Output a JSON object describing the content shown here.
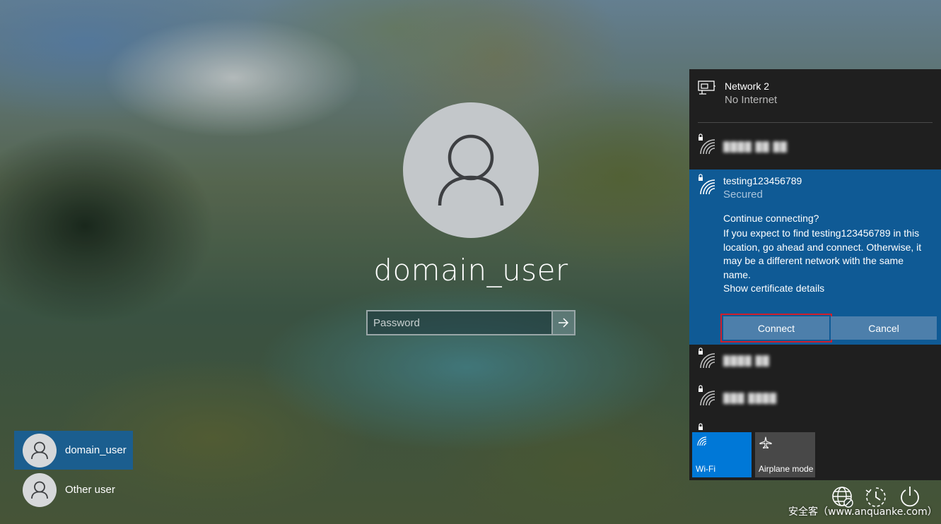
{
  "login": {
    "username": "domain_user",
    "password_placeholder": "Password",
    "submit_icon": "arrow-right-icon"
  },
  "users": [
    {
      "name": "domain_user",
      "active": true
    },
    {
      "name": "Other user",
      "active": false
    }
  ],
  "network": {
    "wired": {
      "name": "Network 2",
      "status": "No Internet",
      "icon": "ethernet-icon"
    },
    "hidden_rows": [
      "████ ██ ██",
      "████ ██",
      "███ ████"
    ],
    "selected": {
      "name": "testing123456789",
      "status": "Secured",
      "question": "Continue connecting?",
      "message": "If you expect to find testing123456789 in this location, go ahead and connect. Otherwise, it may be a different network with the same name.",
      "cert_link": "Show certificate details",
      "connect_label": "Connect",
      "cancel_label": "Cancel"
    },
    "tiles": [
      {
        "label": "Wi-Fi",
        "icon": "wifi-icon",
        "active": true
      },
      {
        "label": "Airplane mode",
        "icon": "airplane-icon",
        "active": false
      }
    ]
  },
  "tray": {
    "icons": [
      "network-globe-icon",
      "ease-of-access-icon",
      "power-icon"
    ]
  },
  "watermark": "安全客（www.anquanke.com）",
  "colors": {
    "selected_bg": "#0f5a95",
    "flyout_bg": "#1f1f1f",
    "accent": "#0078d7",
    "highlight_border": "#d01e2b"
  }
}
